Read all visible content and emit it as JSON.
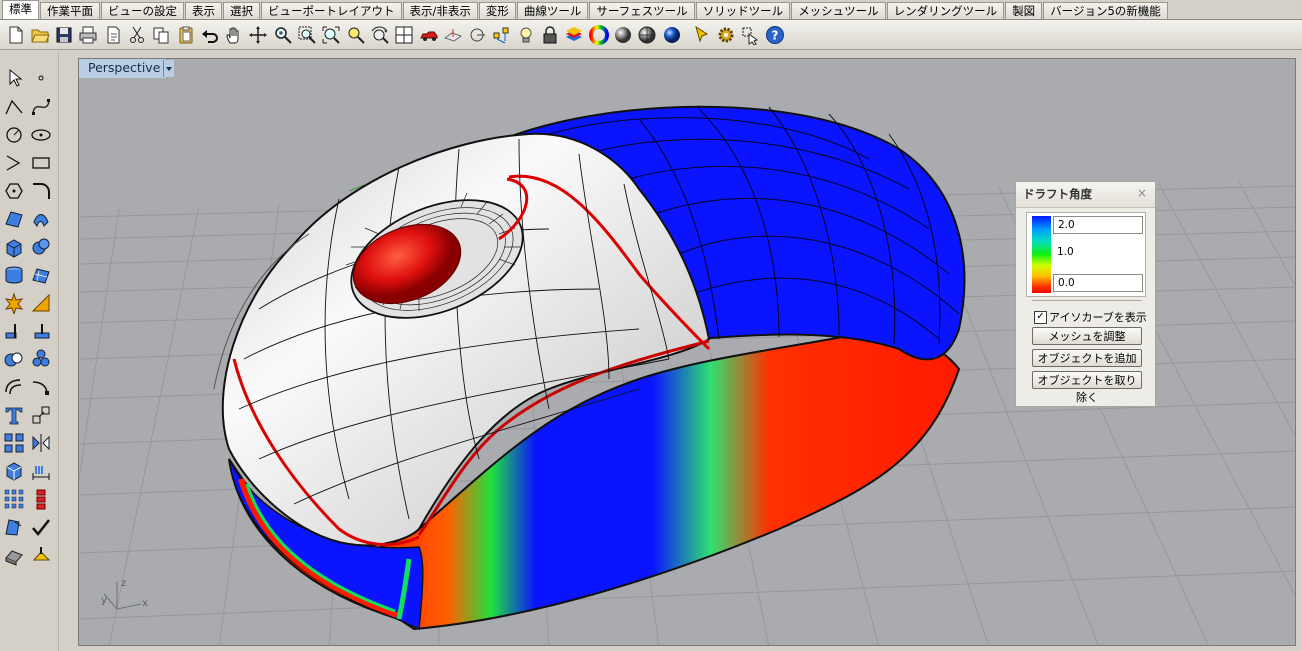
{
  "menu_tabs": [
    "標準",
    "作業平面",
    "ビューの設定",
    "表示",
    "選択",
    "ビューポートレイアウト",
    "表示/非表示",
    "変形",
    "曲線ツール",
    "サーフェスツール",
    "ソリッドツール",
    "メッシュツール",
    "レンダリングツール",
    "製図",
    "バージョン5の新機能"
  ],
  "active_tab": "標準",
  "toolbar_icons": [
    "new-file-icon",
    "open-folder-icon",
    "save-icon",
    "print-icon",
    "import-icon",
    "cut-icon",
    "copy-icon",
    "paste-icon",
    "undo-icon",
    "pan-hand-icon",
    "rotate-view-icon",
    "zoom-icon",
    "zoom-window-icon",
    "zoom-extents-icon",
    "zoom-selected-icon",
    "rotate-camera-icon",
    "four-viewports-icon",
    "car-render-icon",
    "set-cplane-icon",
    "cplane-origin-icon",
    "object-snap-icon",
    "light-bulb-icon",
    "lock-icon",
    "layer-icon",
    "color-wheel-icon",
    "shaded-sphere-icon",
    "rendered-sphere-icon",
    "blue-sphere-icon",
    "cursor-options-icon",
    "gear-settings-icon",
    "select-region-icon",
    "help-icon"
  ],
  "palette_icons": [
    "select-arrow-icon",
    "point-icon",
    "polyline-icon",
    "curve-icon",
    "circle-icon",
    "ellipse-icon",
    "arc-icon",
    "rectangle-icon",
    "polygon-icon",
    "fillet-icon",
    "surface-icon",
    "surface-edge-icon",
    "box-solid-icon",
    "sphere-solid-icon",
    "cylinder-solid-icon",
    "mesh-icon",
    "explode-icon",
    "trim-icon",
    "split-icon",
    "join-icon",
    "boolean-icon",
    "group-icon",
    "offset-icon",
    "fillet-curve-icon",
    "text-icon",
    "scale-icon",
    "array-icon",
    "mirror-icon",
    "block-icon",
    "dimension-icon",
    "grid-array-icon",
    "history-icon",
    "analyze-icon",
    "check-icon",
    "render-icon",
    "hide-icon"
  ],
  "viewport": {
    "name": "Perspective",
    "axis_labels": {
      "x": "x",
      "y": "y",
      "z": "z"
    }
  },
  "draft_panel": {
    "title": "ドラフト角度",
    "close": "×",
    "max_value": "2.0",
    "mid_value": "1.0",
    "min_value": "0.0",
    "show_iso_label": "アイソカーブを表示",
    "show_iso_checked": "✓",
    "adjust_mesh_label": "メッシュを調整",
    "add_object_label": "オブジェクトを追加",
    "remove_object_label": "オブジェクトを取り除く"
  },
  "colors": {
    "viewport_bg": "#a9abae",
    "grid_line": "#95979a",
    "model_white": "#ececec",
    "model_blue": "#0a14ff",
    "model_red": "#ff1a00",
    "accent_tab": "#b9cde3"
  }
}
